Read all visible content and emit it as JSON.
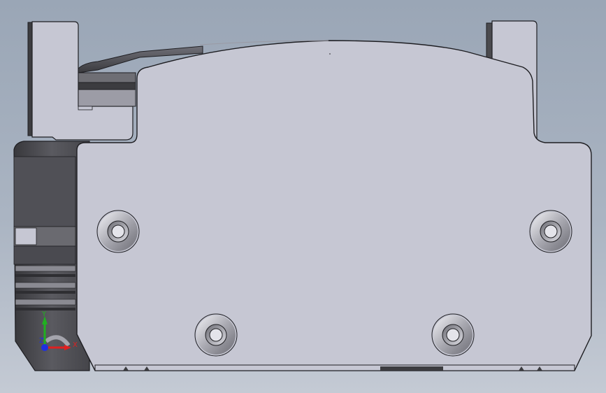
{
  "viewport": {
    "background_top": "#9aa6b6",
    "background_bottom": "#c4cad4"
  },
  "model": {
    "face_color": "#c6c7d3",
    "edge_color": "#1e1e22",
    "side_dark_color": "#4a4a4e",
    "counterbore_holes": 4
  },
  "triad": {
    "x_label": "X",
    "y_label": "Y",
    "z_label": "Z",
    "x_color": "#e02020",
    "y_color": "#20b020",
    "z_color": "#2030e0"
  }
}
